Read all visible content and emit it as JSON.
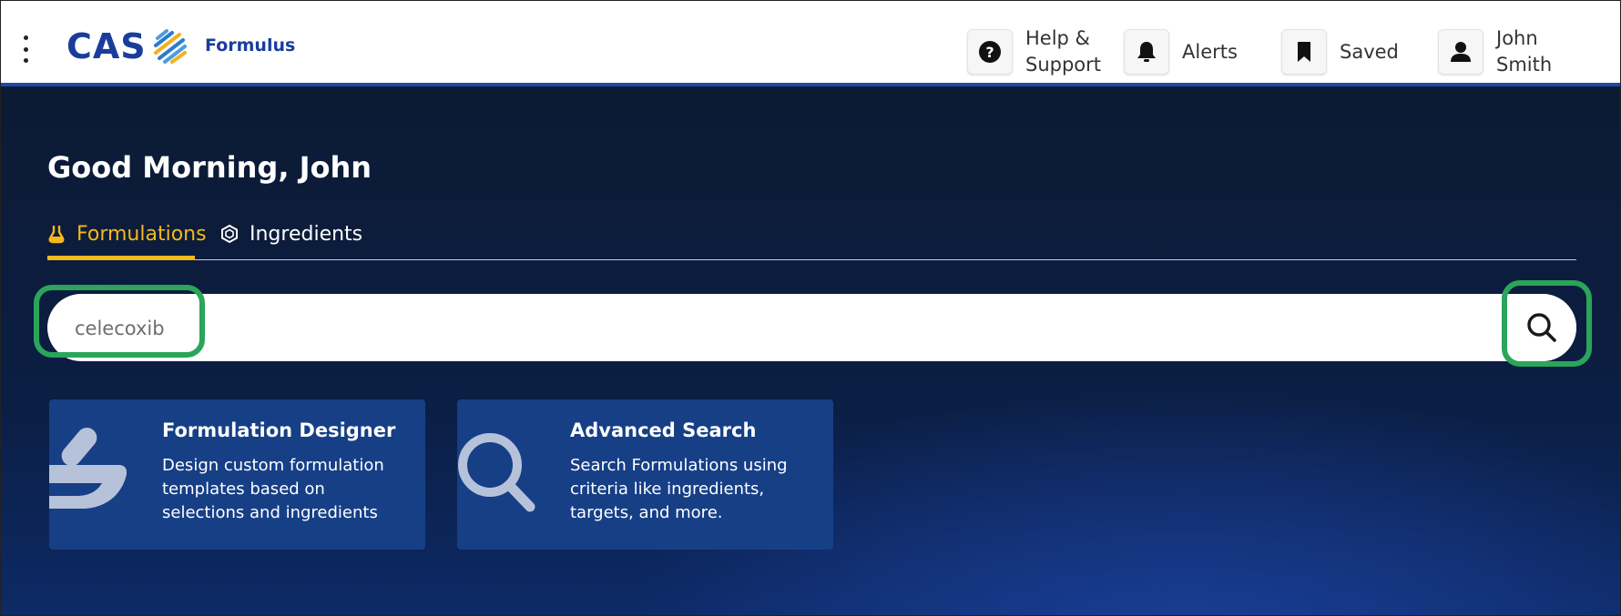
{
  "header": {
    "logo_text": "CAS",
    "brand": "Formulus",
    "nav": {
      "help": "Help & Support",
      "alerts": "Alerts",
      "saved": "Saved",
      "user": "John Smith"
    },
    "colors": {
      "brand": "#1a3d9c",
      "accent_bar": "#1b4aa8"
    }
  },
  "hero": {
    "greeting": "Good Morning, John",
    "tabs": [
      {
        "label": "Formulations",
        "icon": "flask-icon",
        "active": true
      },
      {
        "label": "Ingredients",
        "icon": "hexagon-icon",
        "active": false
      }
    ],
    "search": {
      "value": "celecoxib",
      "button_icon": "search-icon"
    },
    "cards": [
      {
        "title": "Formulation Designer",
        "description": "Design custom formulation templates based on selections and ingredients",
        "icon": "mortar-pestle-icon"
      },
      {
        "title": "Advanced Search",
        "description": "Search Formulations using criteria like ingredients, targets, and more.",
        "icon": "magnifier-icon"
      }
    ],
    "colors": {
      "active_tab": "#f5b81a",
      "highlight": "#2aa55a",
      "card_bg": "#163f86"
    }
  }
}
